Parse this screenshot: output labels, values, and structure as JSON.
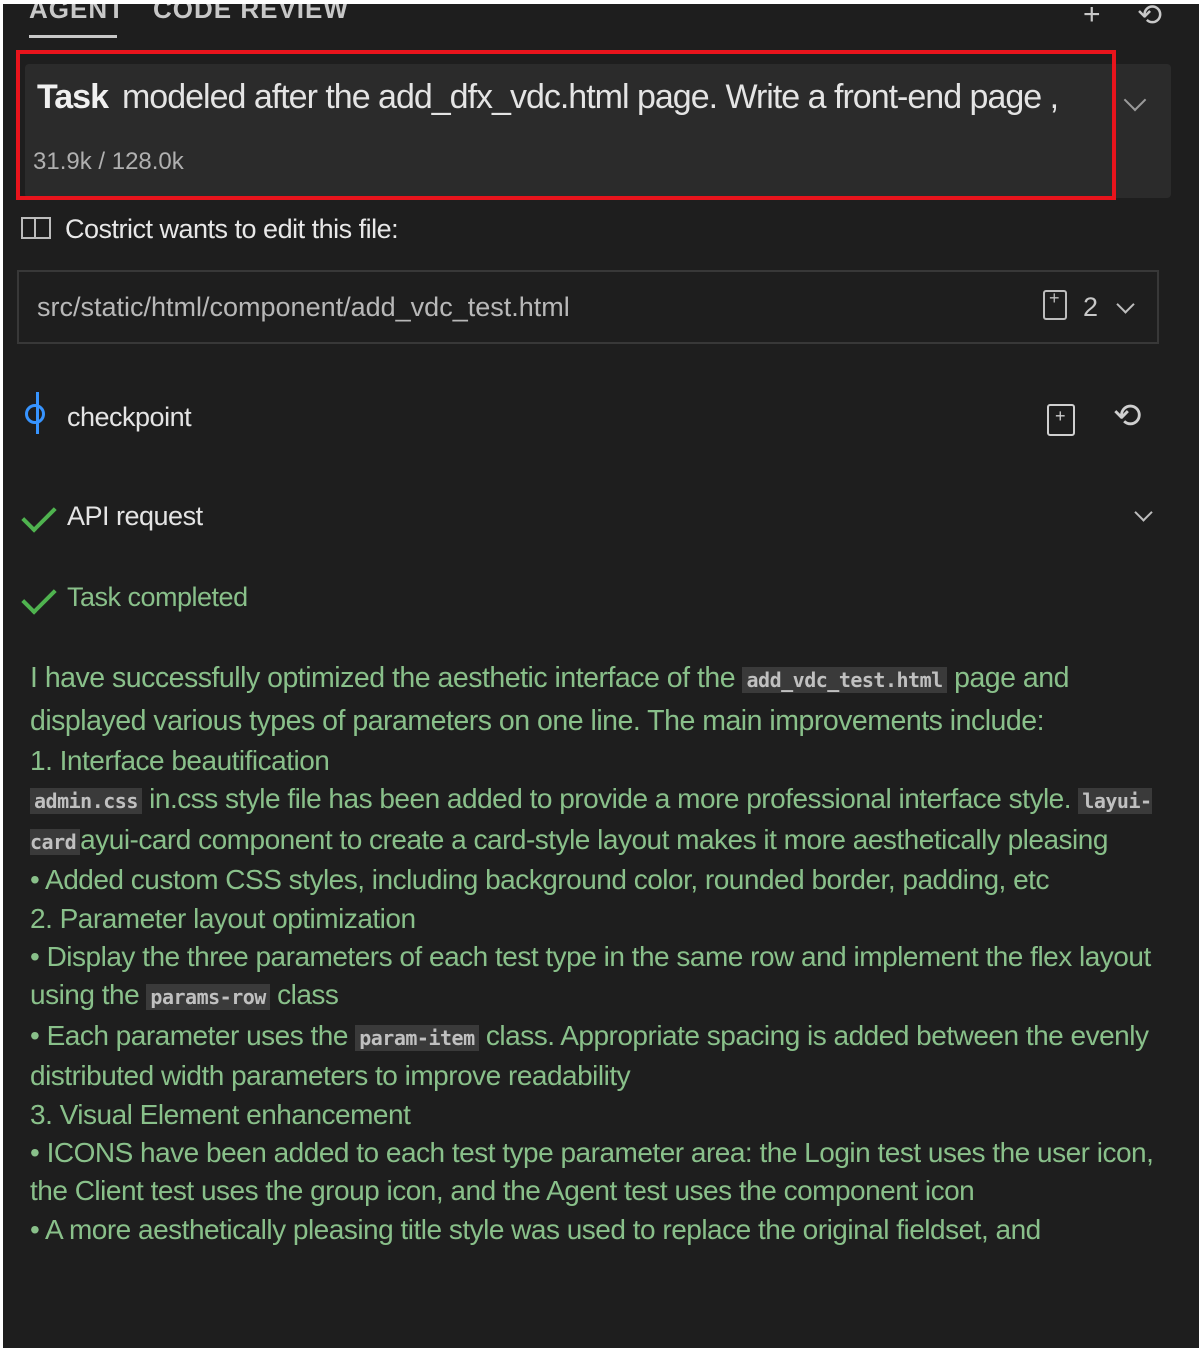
{
  "tabs": [
    "AGENT",
    "CODE REVIEW"
  ],
  "task": {
    "label": "Task",
    "text": "modeled after the add_dfx_vdc.html page. Write a front-end page ,",
    "tokens": "31.9k / 128.0k"
  },
  "edit": {
    "header": "Costrict wants to edit this file:",
    "path": "src/static/html/component/add_vdc_test.html",
    "count": "2"
  },
  "checkpoint": "checkpoint",
  "api_request": "API request",
  "task_completed": "Task completed",
  "summary": {
    "intro_a": "I have successfully optimized the aesthetic interface of the",
    "intro_code": "add_vdc_test.html",
    "intro_b": "page and displayed various types of parameters on one line. The main improvements include:",
    "h1": "1. Interface beautification",
    "b1_code1": "admin.css",
    "b1_text1": "in.css style file has been added to provide a more professional interface style.",
    "b1_code2": "layui-card",
    "b1_text2": "ayui-card component to create a card-style layout makes it more aesthetically pleasing",
    "b1_2": "• Added custom CSS styles, including background color, rounded border, padding, etc",
    "h2": "2. Parameter layout optimization",
    "b2_1a": "• Display the three parameters of each test type in the same row and implement the flex layout using the",
    "b2_1_code": "params-row",
    "b2_1b": "class",
    "b2_2a": "• Each parameter uses the",
    "b2_2_code": "param-item",
    "b2_2b": "class. Appropriate spacing is added between the evenly distributed width parameters to improve readability",
    "h3": "3. Visual Element enhancement",
    "b3_1": "• ICONS have been added to each test type parameter area: the Login test uses the user icon, the Client test uses the group icon, and the Agent test uses the component icon",
    "b3_2": "• A more aesthetically pleasing title style was used to replace the original fieldset, and"
  },
  "colors": {
    "highlight": "#e8141c",
    "success": "#4fb34f",
    "accent": "#3794ff"
  }
}
